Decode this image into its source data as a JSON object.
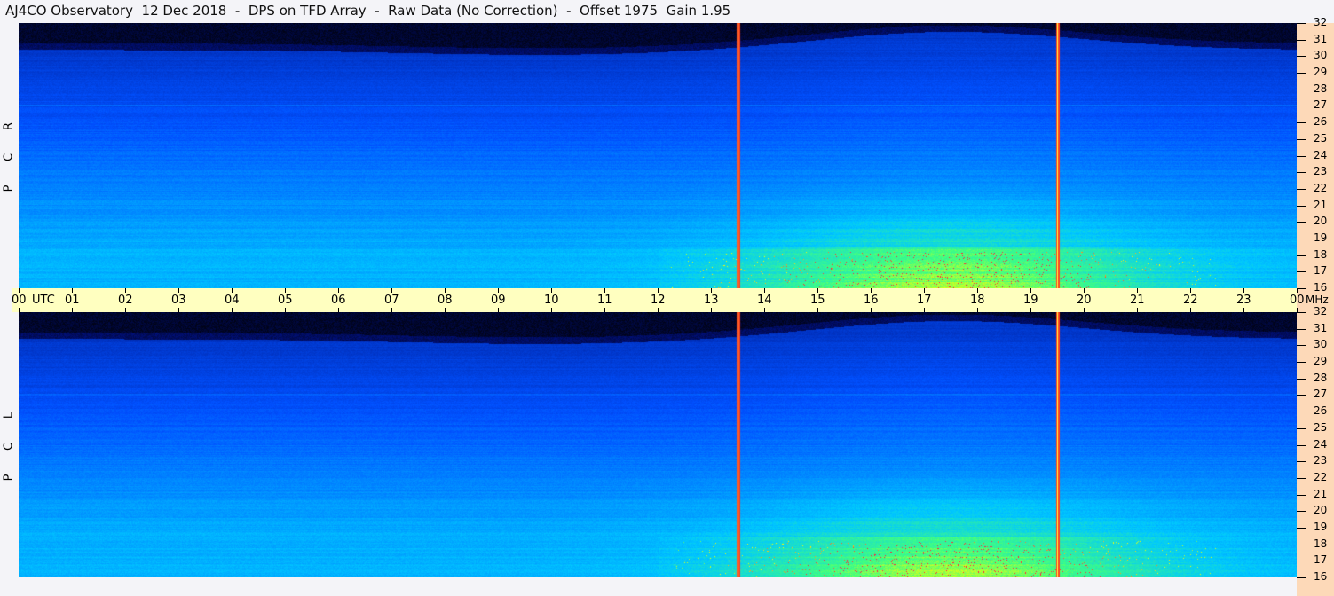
{
  "title": "AJ4CO Observatory  12 Dec 2018  -  DPS on TFD Array  -  Raw Data (No Correction)  -  Offset 1975  Gain 1.95",
  "chart_data": {
    "type": "heatmap",
    "title": "AJ4CO Observatory  12 Dec 2018  -  DPS on TFD Array  -  Raw Data (No Correction)  -  Offset 1975  Gain 1.95",
    "xlabel": "UTC",
    "ylabel": "MHz",
    "x_range": [
      0,
      24
    ],
    "y_range": [
      16,
      32
    ],
    "x_ticks": [
      "00",
      "01",
      "02",
      "03",
      "04",
      "05",
      "06",
      "07",
      "08",
      "09",
      "10",
      "11",
      "12",
      "13",
      "14",
      "15",
      "16",
      "17",
      "18",
      "19",
      "20",
      "21",
      "22",
      "23",
      "00"
    ],
    "y_ticks": [
      "16",
      "17",
      "18",
      "19",
      "20",
      "21",
      "22",
      "23",
      "24",
      "25",
      "26",
      "27",
      "28",
      "29",
      "30",
      "31",
      "32"
    ],
    "panels": [
      {
        "name": "RCP",
        "label": [
          "R",
          "C",
          "P"
        ]
      },
      {
        "name": "LCP",
        "label": [
          "L",
          "C",
          "P"
        ]
      }
    ],
    "marker_lines_utc": [
      13.5,
      19.5
    ],
    "colormap": [
      "#000000",
      "#00107a",
      "#0050ff",
      "#00c8ff",
      "#40ff80",
      "#ffff00",
      "#ff2040"
    ]
  }
}
